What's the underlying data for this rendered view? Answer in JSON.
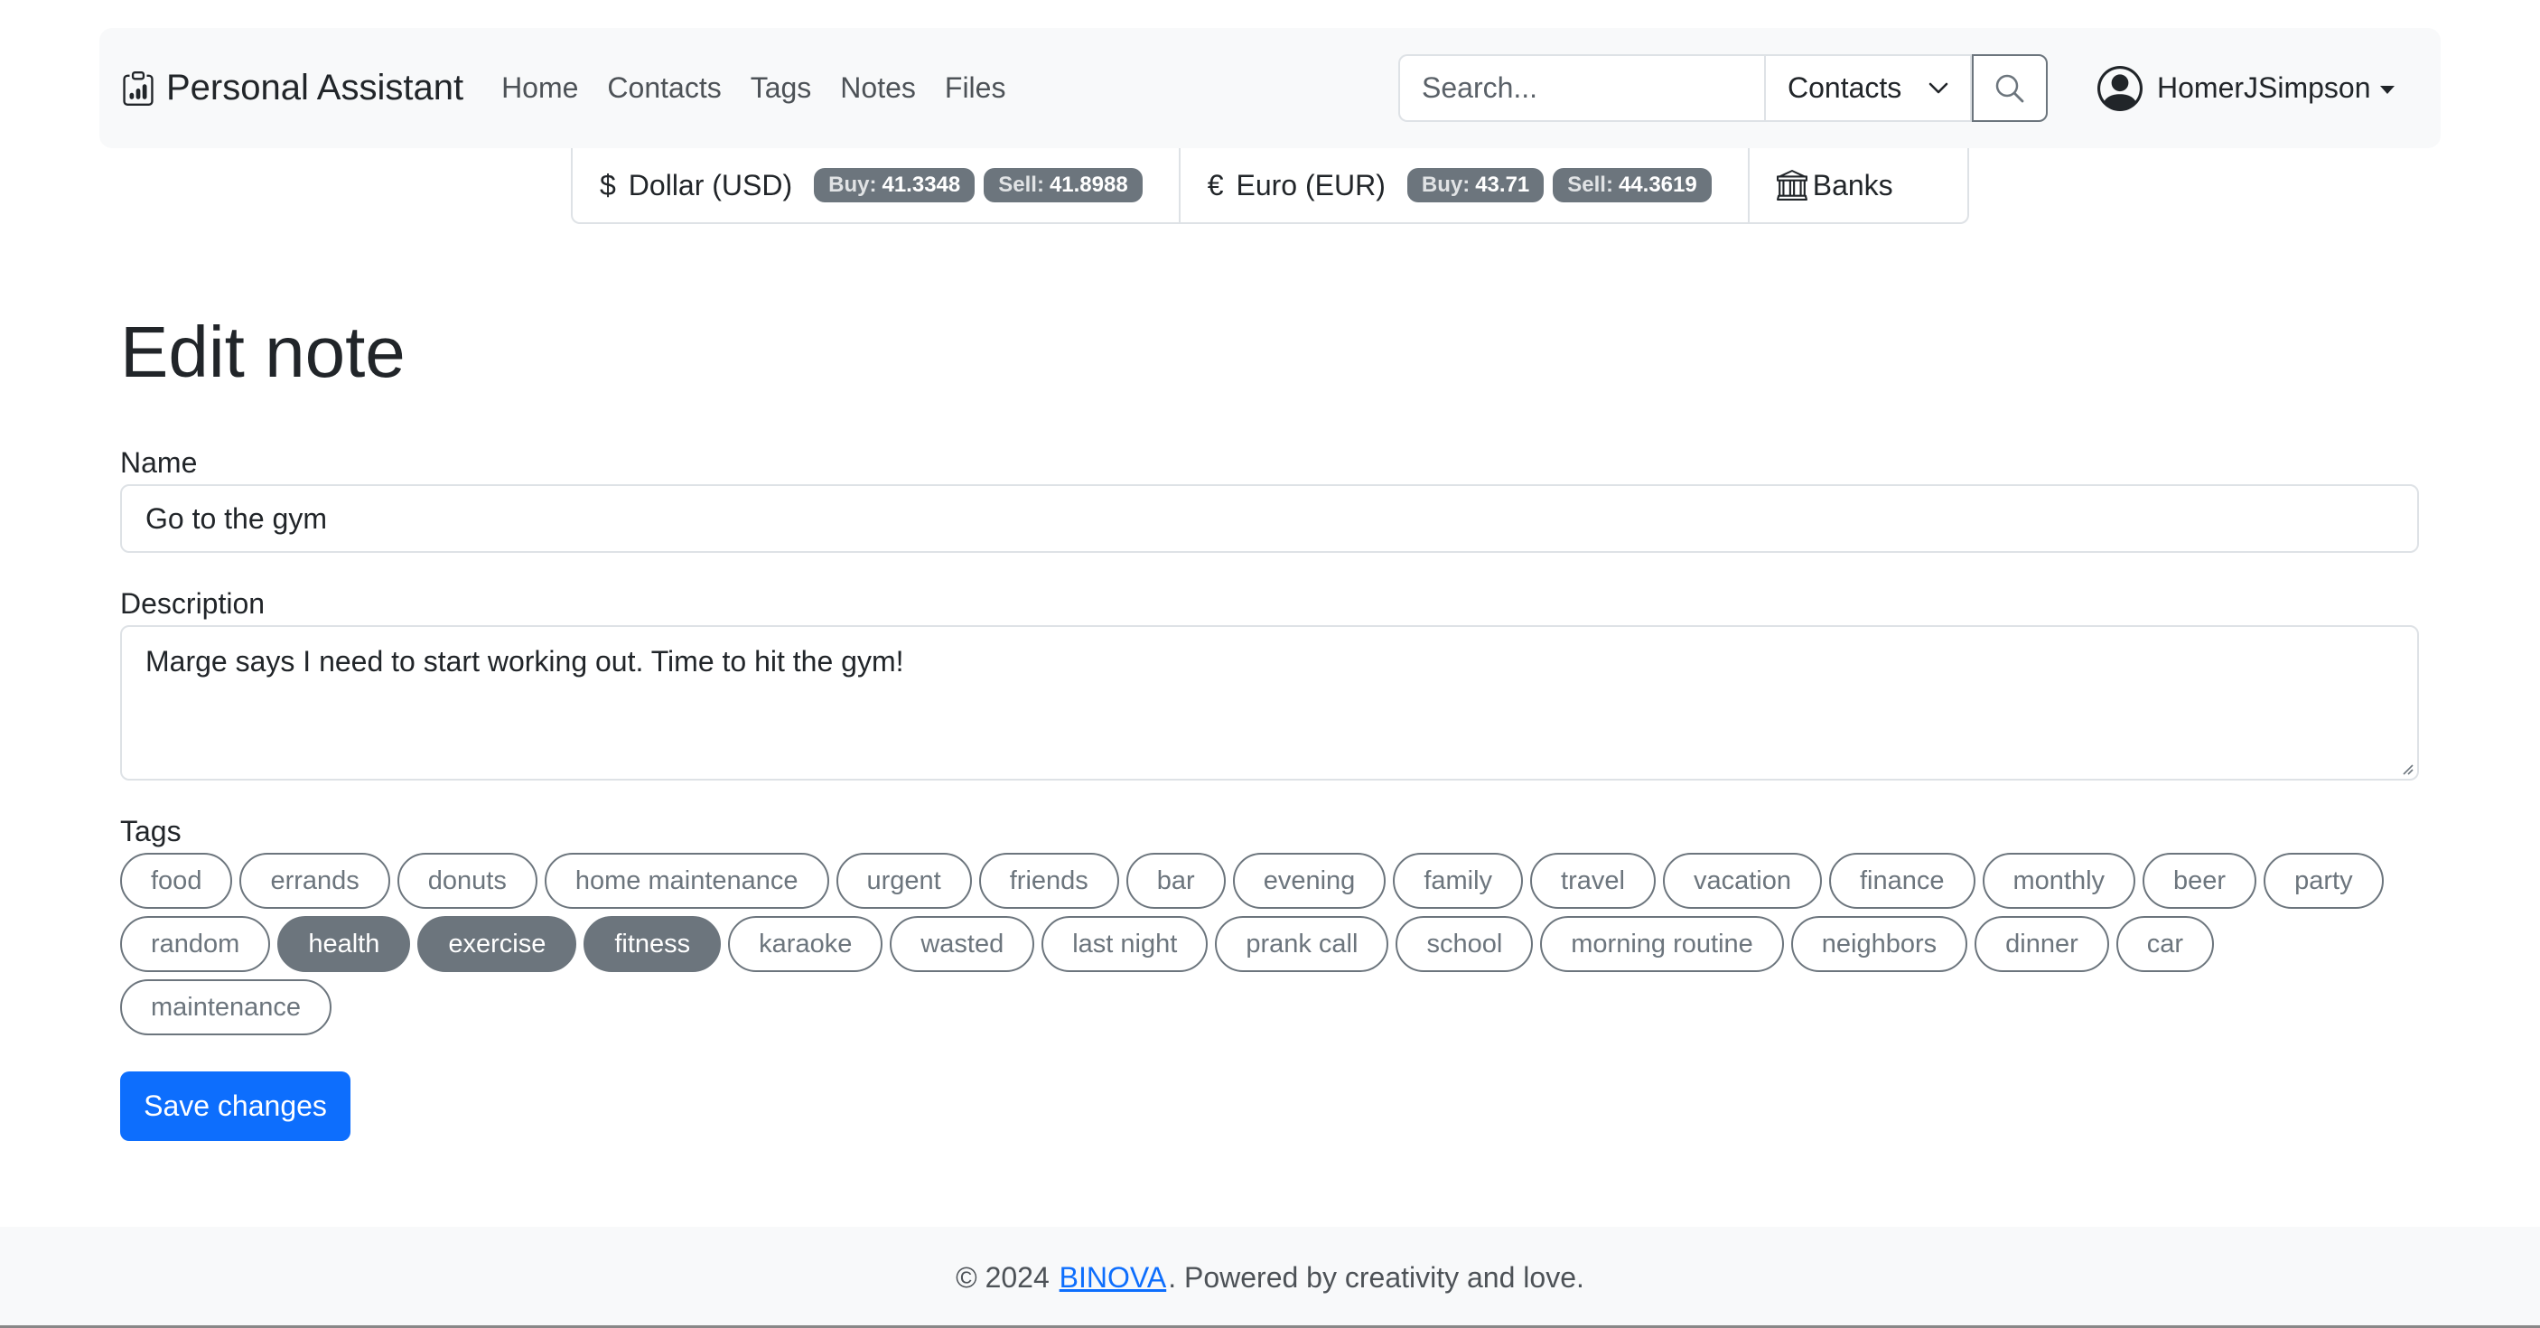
{
  "navbar": {
    "brand": "Personal Assistant",
    "links": [
      "Home",
      "Contacts",
      "Tags",
      "Notes",
      "Files"
    ],
    "search": {
      "placeholder": "Search...",
      "value": "",
      "category": "Contacts"
    },
    "user": "HomerJSimpson"
  },
  "rates": {
    "usd": {
      "symbol": "$",
      "label": "Dollar (USD)",
      "buy_label": "Buy:",
      "buy": "41.3348",
      "sell_label": "Sell:",
      "sell": "41.8988"
    },
    "eur": {
      "symbol": "€",
      "label": "Euro (EUR)",
      "buy_label": "Buy:",
      "buy": "43.71",
      "sell_label": "Sell:",
      "sell": "44.3619"
    },
    "banks": "Banks"
  },
  "form": {
    "title": "Edit note",
    "name_label": "Name",
    "name_value": "Go to the gym",
    "description_label": "Description",
    "description_value": "Marge says I need to start working out. Time to hit the gym!",
    "tags_label": "Tags",
    "tags": [
      [
        "food",
        "errands",
        "donuts",
        "home maintenance",
        "urgent",
        "friends",
        "bar",
        "evening",
        "family",
        "travel",
        "vacation",
        "finance",
        "monthly",
        "beer",
        "party"
      ],
      [
        "random",
        "health",
        "exercise",
        "fitness",
        "karaoke",
        "wasted",
        "last night",
        "prank call",
        "school",
        "morning routine",
        "neighbors",
        "dinner",
        "car"
      ],
      [
        "maintenance"
      ]
    ],
    "selected_tags": [
      "health",
      "exercise",
      "fitness"
    ],
    "save_label": "Save changes"
  },
  "footer": {
    "prefix": "© 2024 ",
    "link": "BINOVA",
    "suffix": ". Powered by creativity and love."
  },
  "colors": {
    "primary": "#0d6efd",
    "secondary": "#6c757d",
    "navbar_bg": "#f8f9fa"
  }
}
